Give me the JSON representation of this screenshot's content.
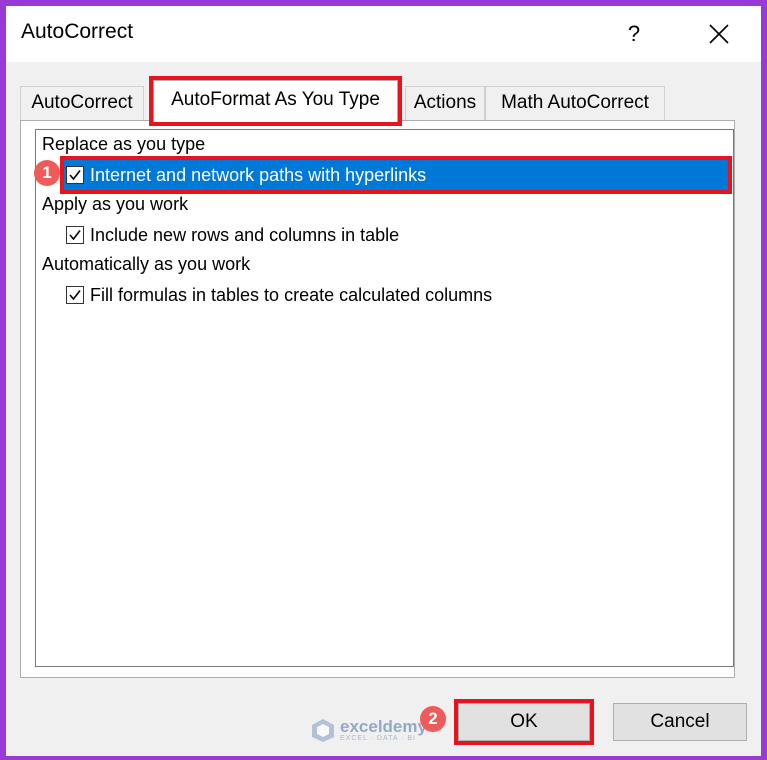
{
  "window": {
    "title": "AutoCorrect",
    "help_glyph": "?"
  },
  "tabs": [
    {
      "label": "AutoCorrect",
      "active": false
    },
    {
      "label": "AutoFormat As You Type",
      "active": true
    },
    {
      "label": "Actions",
      "active": false
    },
    {
      "label": "Math AutoCorrect",
      "active": false
    }
  ],
  "sections": [
    {
      "label": "Replace as you type",
      "options": [
        {
          "label": "Internet and network paths with hyperlinks",
          "checked": true,
          "selected": true
        }
      ]
    },
    {
      "label": "Apply as you work",
      "options": [
        {
          "label": "Include new rows and columns in table",
          "checked": true,
          "selected": false
        }
      ]
    },
    {
      "label": "Automatically as you work",
      "options": [
        {
          "label": "Fill formulas in tables to create calculated columns",
          "checked": true,
          "selected": false
        }
      ]
    }
  ],
  "buttons": {
    "ok": "OK",
    "cancel": "Cancel"
  },
  "steps": [
    "1",
    "2"
  ],
  "watermark": {
    "name": "exceldemy",
    "tagline": "EXCEL · DATA · BI"
  },
  "colors": {
    "highlight": "#e8141c",
    "selection": "#0078d7",
    "step_badge": "#f05a5a",
    "frame": "#9a3ad6"
  }
}
